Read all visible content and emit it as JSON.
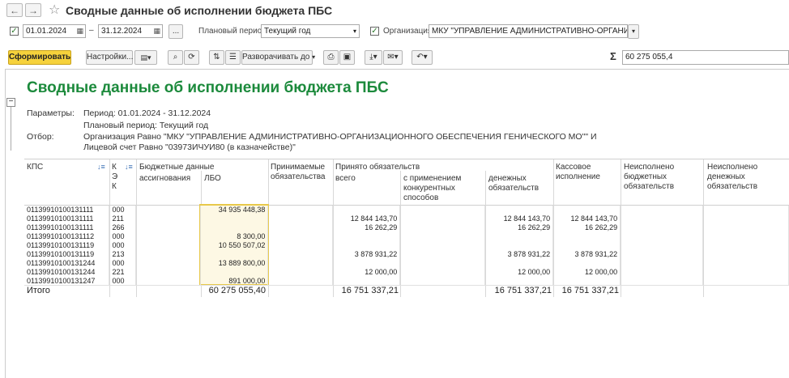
{
  "window": {
    "title": "Сводные данные об исполнении бюджета ПБС",
    "back_icon": "←",
    "forward_icon": "→",
    "star_icon": "☆"
  },
  "filters": {
    "date_from": "01.01.2024",
    "date_separator": "–",
    "date_to": "31.12.2024",
    "more_button": "...",
    "plan_period_label": "Плановый период:",
    "plan_period_value": "Текущий год",
    "org_label": "Организация:",
    "org_value": "МКУ \"УПРАВЛЕНИЕ АДМИНИСТРАТИВНО-ОРГАНИЗАЦИОНН"
  },
  "toolbar": {
    "generate": "Сформировать",
    "settings": "Настройки...",
    "expand": "Разворачивать до",
    "sigma": "Σ",
    "sum_value": "60 275 055,4"
  },
  "report": {
    "title": "Сводные данные об исполнении бюджета ПБС",
    "params_label": "Параметры:",
    "period_line": "Период: 01.01.2024 - 31.12.2024",
    "plan_line": "Плановый период: Текущий год",
    "filter_label": "Отбор:",
    "filter_line1": "Организация Равно \"МКУ \"УПРАВЛЕНИЕ АДМИНИСТРАТИВНО-ОРГАНИЗАЦИОННОГО ОБЕСПЕЧЕНИЯ ГЕНИЧЕСКОГО МО\"\" И",
    "filter_line2": "Лицевой счет Равно \"03973ИЧУИ80 (в казначействе)\""
  },
  "headers": {
    "kps": "КПС",
    "kek1": "К",
    "kek2": "Э",
    "kek3": "К",
    "budget": "Бюджетные данные",
    "assign": "ассигнования",
    "lbo": "ЛБО",
    "accepted": "Принимаемые",
    "accepted2": "обязательства",
    "taken": "Принято обязательств",
    "total": "всего",
    "competitive1": "с применением",
    "competitive2": "конкурентных",
    "competitive3": "способов",
    "money1": "денежных",
    "money2": "обязательств",
    "cash1": "Кассовое",
    "cash2": "исполнение",
    "unb1": "Неисполнено",
    "unb2": "бюджетных",
    "unb3": "обязательств",
    "unm1": "Неисполнено",
    "unm2": "денежных",
    "unm3": "обязательств"
  },
  "rows": [
    {
      "kps": "01139910100131111",
      "kek": "000",
      "lbo": "34 935 448,38",
      "total": "",
      "money": "",
      "cash": ""
    },
    {
      "kps": "01139910100131111",
      "kek": "211",
      "lbo": "",
      "total": "12 844 143,70",
      "money": "12 844 143,70",
      "cash": "12 844 143,70"
    },
    {
      "kps": "01139910100131111",
      "kek": "266",
      "lbo": "",
      "total": "16 262,29",
      "money": "16 262,29",
      "cash": "16 262,29"
    },
    {
      "kps": "01139910100131112",
      "kek": "000",
      "lbo": "8 300,00",
      "total": "",
      "money": "",
      "cash": ""
    },
    {
      "kps": "01139910100131119",
      "kek": "000",
      "lbo": "10 550 507,02",
      "total": "",
      "money": "",
      "cash": ""
    },
    {
      "kps": "01139910100131119",
      "kek": "213",
      "lbo": "",
      "total": "3 878 931,22",
      "money": "3 878 931,22",
      "cash": "3 878 931,22"
    },
    {
      "kps": "01139910100131244",
      "kek": "000",
      "lbo": "13 889 800,00",
      "total": "",
      "money": "",
      "cash": ""
    },
    {
      "kps": "01139910100131244",
      "kek": "221",
      "lbo": "",
      "total": "12 000,00",
      "money": "12 000,00",
      "cash": "12 000,00"
    },
    {
      "kps": "01139910100131247",
      "kek": "000",
      "lbo": "891 000,00",
      "total": "",
      "money": "",
      "cash": ""
    }
  ],
  "totals": {
    "label": "Итого",
    "lbo": "60 275 055,40",
    "total": "16 751 337,21",
    "money": "16 751 337,21",
    "cash": "16 751 337,21"
  },
  "colors": {
    "accent_green": "#1c8a3c",
    "selection": "#e8c94a",
    "selection_fill": "#fdf8e4"
  }
}
